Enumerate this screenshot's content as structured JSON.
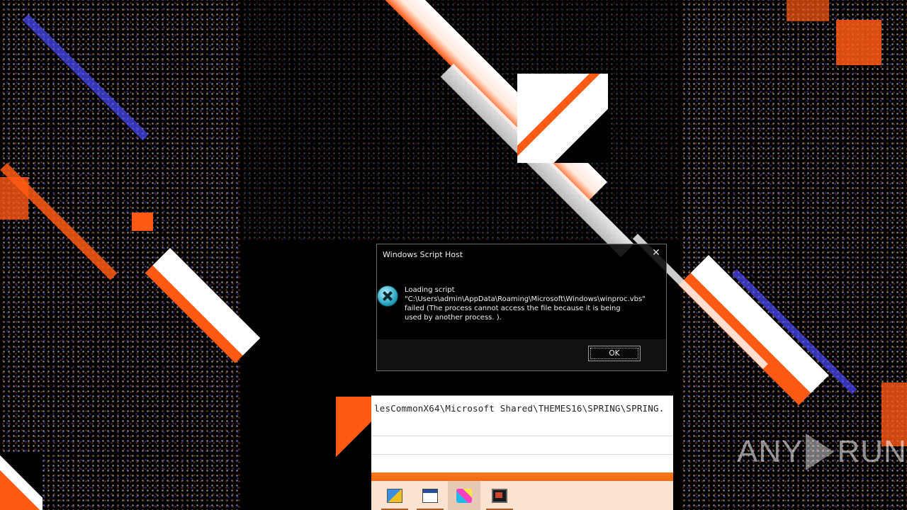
{
  "dialog": {
    "title": "Windows Script Host",
    "close_glyph": "✕",
    "message": "Loading script \"C:\\Users\\admin\\AppData\\Roaming\\Microsoft\\Windows\\winproc.vbs\" failed (The process cannot access the file because it is being used by another process. ).",
    "ok_label": "OK",
    "icon": "error-icon"
  },
  "console": {
    "line": "lesCommonX64\\Microsoft Shared\\THEMES16\\SPRING\\SPRING."
  },
  "taskbar": {
    "items": [
      {
        "icon": "explorer-icon",
        "active": false
      },
      {
        "icon": "console-icon",
        "active": false
      },
      {
        "icon": "paint-icon",
        "active": true
      },
      {
        "icon": "media-icon",
        "active": false
      }
    ],
    "accent": "#f06a10"
  },
  "watermark": {
    "left": "ANY",
    "right": "RUN"
  },
  "colors": {
    "glitch_orange": "#ff5a14",
    "glitch_white": "#ffffff",
    "glitch_blue": "#4b4bff",
    "background": "#000000"
  }
}
